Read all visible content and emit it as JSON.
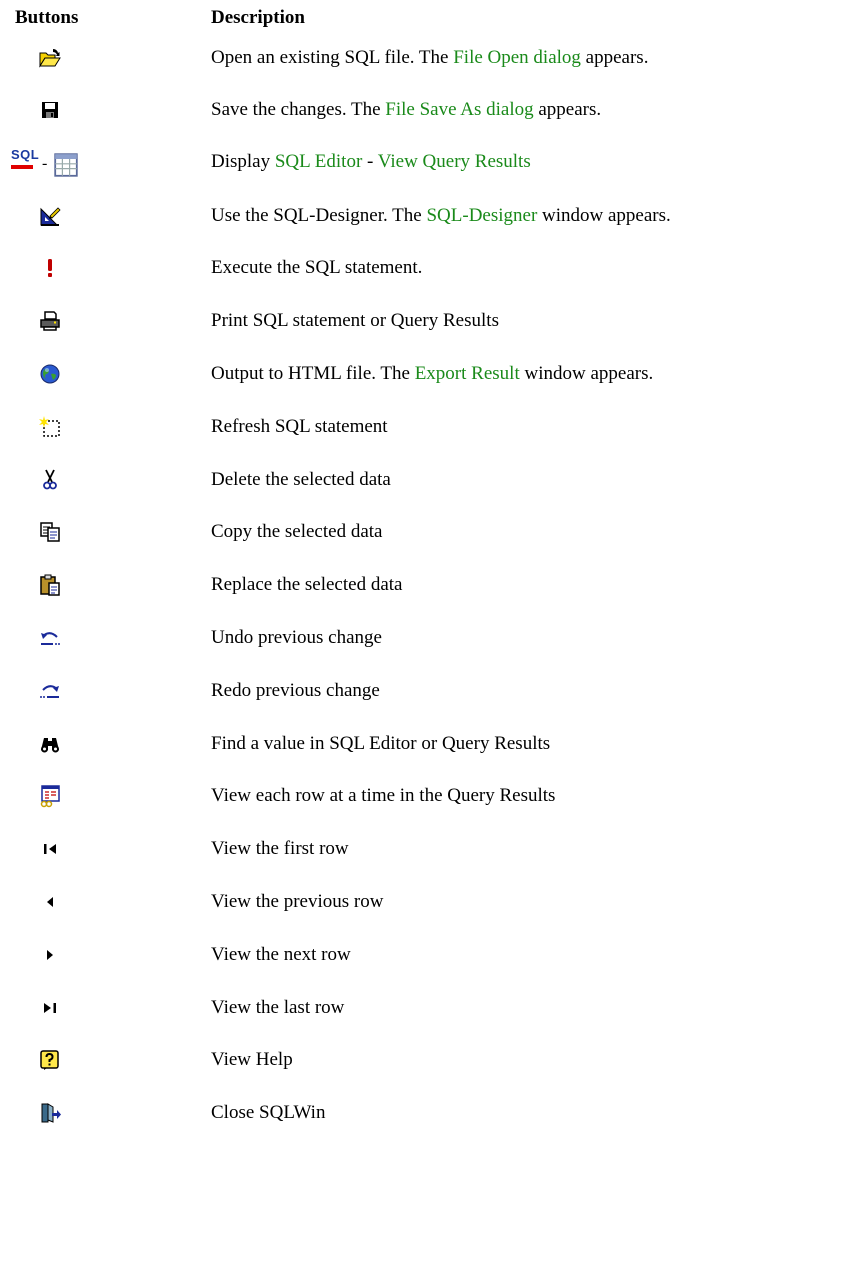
{
  "headers": {
    "buttons": "Buttons",
    "description": "Description"
  },
  "rows": [
    {
      "icon": "open-folder-icon",
      "parts": [
        "Open an existing SQL file.  The ",
        "File Open dialog",
        " appears."
      ]
    },
    {
      "icon": "save-disk-icon",
      "parts": [
        "Save the changes.  The ",
        "File Save As dialog",
        " appears."
      ]
    },
    {
      "icon": "sql-editor-icon",
      "parts": [
        "Display ",
        "SQL Editor",
        " - ",
        "View Query Results",
        ""
      ],
      "icon_text": "SQL",
      "icon_sep": "-"
    },
    {
      "icon": "sql-designer-icon",
      "parts": [
        "Use the SQL-Designer.  The ",
        "SQL-Designer",
        " window appears."
      ]
    },
    {
      "icon": "exclamation-icon",
      "parts": [
        "Execute the SQL statement."
      ]
    },
    {
      "icon": "printer-icon",
      "parts": [
        "Print SQL statement or Query Results"
      ]
    },
    {
      "icon": "globe-icon",
      "parts": [
        "Output to HTML file.  The ",
        "Export Result",
        " window appears."
      ]
    },
    {
      "icon": "new-document-icon",
      "parts": [
        "Refresh SQL statement"
      ]
    },
    {
      "icon": "scissors-icon",
      "parts": [
        "Delete the selected data"
      ]
    },
    {
      "icon": "copy-icon",
      "parts": [
        "Copy the selected data"
      ]
    },
    {
      "icon": "paste-icon",
      "parts": [
        "Replace the selected data"
      ]
    },
    {
      "icon": "undo-icon",
      "parts": [
        "Undo previous change"
      ]
    },
    {
      "icon": "redo-icon",
      "parts": [
        "Redo previous change"
      ]
    },
    {
      "icon": "binoculars-icon",
      "parts": [
        "Find a value in SQL Editor or Query Results"
      ]
    },
    {
      "icon": "form-view-icon",
      "parts": [
        "View each row at a time in the Query Results"
      ]
    },
    {
      "icon": "first-row-icon",
      "parts": [
        "View the first row"
      ]
    },
    {
      "icon": "previous-row-icon",
      "parts": [
        "View the previous row"
      ]
    },
    {
      "icon": "next-row-icon",
      "parts": [
        "View the next row"
      ]
    },
    {
      "icon": "last-row-icon",
      "parts": [
        "View the last row"
      ]
    },
    {
      "icon": "help-icon",
      "parts": [
        "View Help"
      ]
    },
    {
      "icon": "exit-door-icon",
      "parts": [
        "Close SQLWin"
      ]
    }
  ],
  "colors": {
    "link": "#1a8a1a"
  }
}
